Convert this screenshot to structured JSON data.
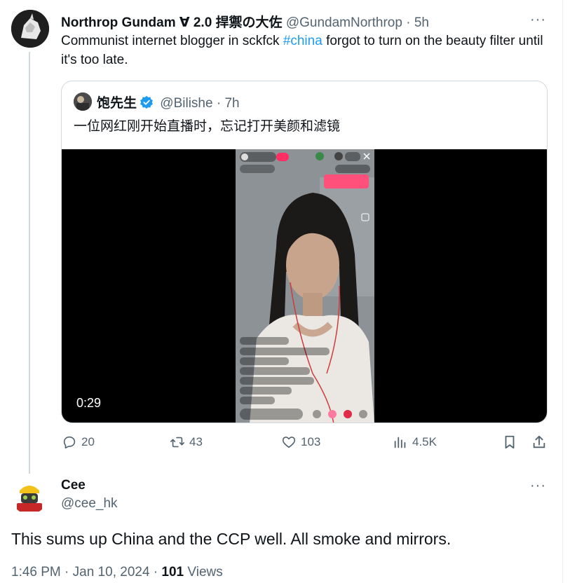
{
  "tweet": {
    "author_name": "Northrop Gundam ∀ 2.0 捍禦の大佐",
    "author_handle": "@GundamNorthrop",
    "time": "· 5h",
    "text_before": "Communist internet blogger in sckfck ",
    "hashtag": "#china",
    "text_after": " forgot to turn on the beauty filter until it's too late.",
    "more": "···"
  },
  "quote": {
    "author_name": "饱先生",
    "author_handle": "@Bilishe",
    "time": "· 7h",
    "text": "一位网红刚开始直播时，忘记打开美颜和滤镜",
    "video_duration": "0:29"
  },
  "actions": {
    "replies": "20",
    "retweets": "43",
    "likes": "103",
    "views": "4.5K"
  },
  "reply": {
    "author_name": "Cee",
    "author_handle": "@cee_hk",
    "text": "This sums up China and the CCP well. All smoke and mirrors.",
    "timestamp": "1:46 PM · Jan 10, 2024 · ",
    "views_count": "101",
    "views_label": " Views",
    "more": "···"
  },
  "colors": {
    "accent": "#1d9bf0",
    "muted": "#536471",
    "border": "#cfd9de"
  }
}
